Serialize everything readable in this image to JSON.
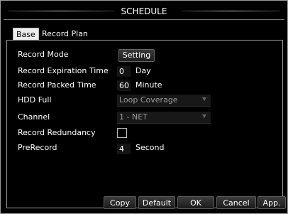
{
  "window": {
    "title": "SCHEDULE"
  },
  "tabs": [
    {
      "label": "Base",
      "active": true
    },
    {
      "label": "Record Plan",
      "active": false
    }
  ],
  "form": {
    "record_mode": {
      "label": "Record Mode",
      "button_label": "Setting"
    },
    "record_expiration": {
      "label": "Record Expiration Time",
      "value": "0",
      "unit": "Day"
    },
    "record_packed": {
      "label": "Record Packed Time",
      "value": "60",
      "unit": "Minute"
    },
    "hdd_full": {
      "label": "HDD Full",
      "value": "Loop Coverage"
    },
    "channel": {
      "label": "Channel",
      "value": "1 - NET"
    },
    "record_redundancy": {
      "label": "Record Redundancy",
      "checked": false
    },
    "prerecord": {
      "label": "PreRecord",
      "value": "4",
      "unit": "Second"
    }
  },
  "footer": {
    "copy": "Copy",
    "default": "Default",
    "ok": "OK",
    "cancel": "Cancel",
    "apply": "App."
  },
  "colors": {
    "background": "#000000",
    "border": "#9a9a9a",
    "active_tab": "#ececec"
  }
}
